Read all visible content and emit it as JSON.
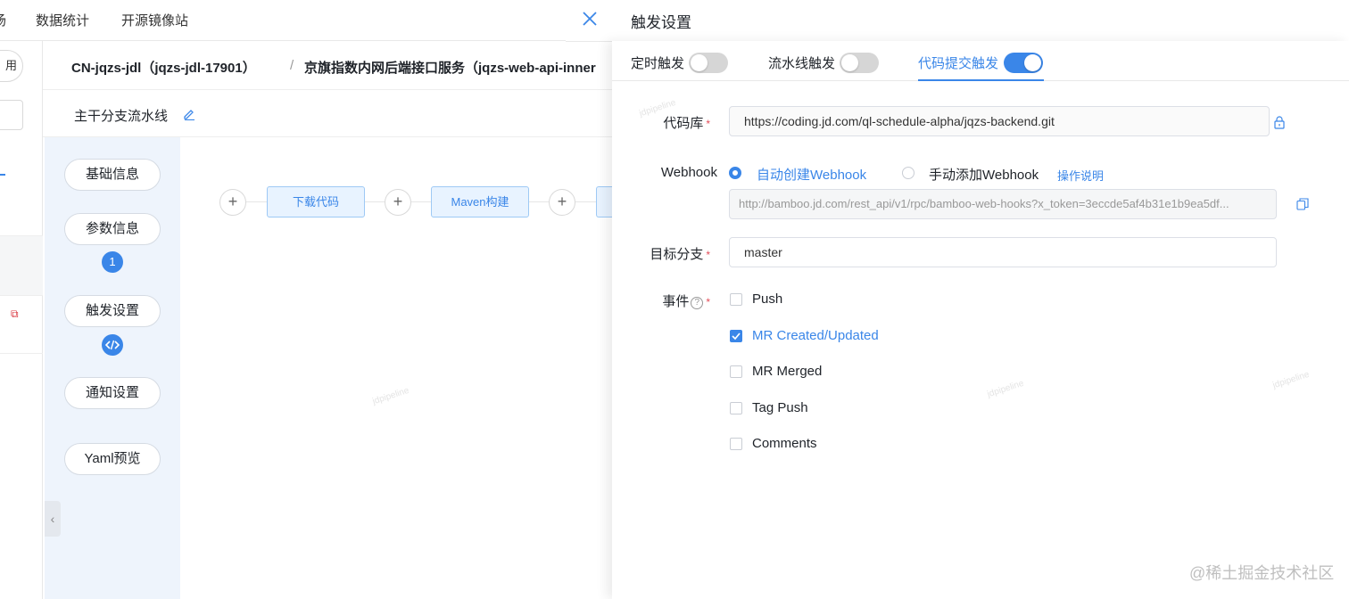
{
  "topnav": {
    "partial_item": "场",
    "items": [
      "数据统计",
      "开源镜像站"
    ]
  },
  "left": {
    "partial_button": "用"
  },
  "breadcrumb": {
    "project": "CN-jqzs-jdl（jqzs-jdl-17901）",
    "separator": "/",
    "service": "京旗指数内网后端接口服务（jqzs-web-api-inner"
  },
  "pipeline": {
    "name": "主干分支流水线"
  },
  "steps": [
    {
      "label": "基础信息"
    },
    {
      "label": "参数信息",
      "badge": "1"
    },
    {
      "label": "触发设置"
    },
    {
      "label": "通知设置"
    },
    {
      "label": "Yaml预览"
    }
  ],
  "canvas": {
    "nodes": [
      "下载代码",
      "Maven构建"
    ],
    "watermark": "jdpipeline"
  },
  "drawer": {
    "title": "触发设置",
    "tabs": [
      {
        "label": "定时触发",
        "enabled": false
      },
      {
        "label": "流水线触发",
        "enabled": false
      },
      {
        "label": "代码提交触发",
        "enabled": true
      }
    ],
    "repo": {
      "label": "代码库",
      "required": "*",
      "value": "https://coding.jd.com/ql-schedule-alpha/jqzs-backend.git"
    },
    "webhook": {
      "label": "Webhook",
      "option_auto": "自动创建Webhook",
      "option_manual": "手动添加Webhook",
      "help_link": "操作说明",
      "url": "http://bamboo.jd.com/rest_api/v1/rpc/bamboo-web-hooks?x_token=3eccde5af4b31e1b9ea5df..."
    },
    "branch": {
      "label": "目标分支",
      "required": "*",
      "value": "master"
    },
    "events": {
      "label": "事件",
      "help": "?",
      "required": "*",
      "options": [
        {
          "label": "Push",
          "checked": false
        },
        {
          "label": "MR Created/Updated",
          "checked": true
        },
        {
          "label": "MR Merged",
          "checked": false
        },
        {
          "label": "Tag Push",
          "checked": false
        },
        {
          "label": "Comments",
          "checked": false
        }
      ]
    }
  },
  "site_watermark": "@稀土掘金技术社区",
  "colors": {
    "accent": "#3a86e8",
    "required": "#e34d59"
  }
}
